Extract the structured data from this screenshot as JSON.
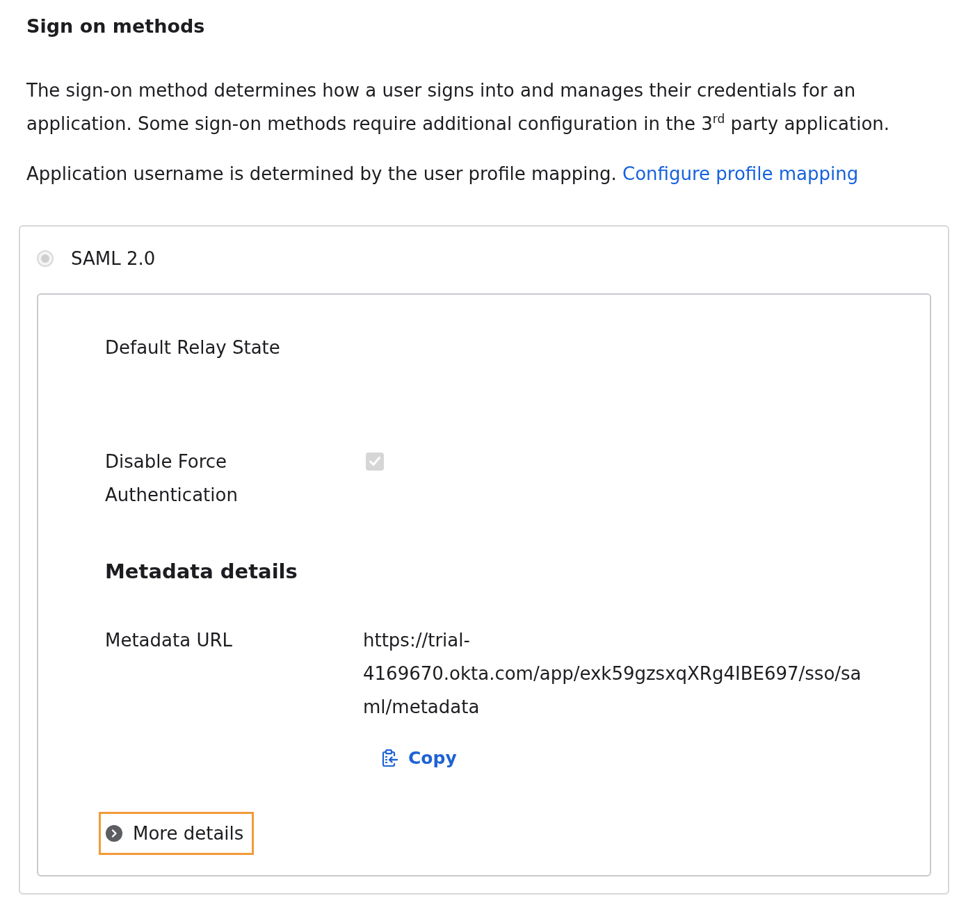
{
  "section": {
    "title": "Sign on methods"
  },
  "description": [
    "The sign-on method determines how a user signs into and manages their credentials for an application. Some sign-on methods require additional configuration in the 3$^{rd}$ party application."
  ],
  "profile_note": {
    "text": "Application username is determined by the user profile mapping.",
    "link": "Configure profile mapping"
  },
  "sign_on_options": [
    {
      "label": "SAML 2.0",
      "selected": true,
      "disabled": true
    }
  ],
  "settings": [
    {
      "kind": "text",
      "label": "Default Relay State"
    },
    {
      "kind": "checkbox",
      "label": "Disable Force Authentication",
      "checked": true,
      "disabled": true
    }
  ],
  "metadata": {
    "title": "Metadata details",
    "fields": [
      {
        "label": "Metadata URL",
        "value": "https://trial-4169670.okta.com/app/exk59gzsxqXRg4IBE697/sso/saml/metadata"
      }
    ],
    "copy_button": "Copy"
  },
  "more_details": {
    "label": "More details",
    "expanded": false,
    "highlighted": true
  }
}
